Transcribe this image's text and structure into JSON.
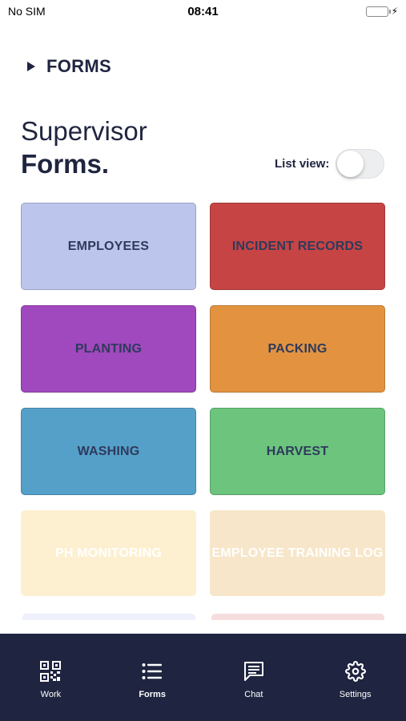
{
  "status_bar": {
    "carrier": "No SIM",
    "time": "08:41",
    "battery_color": "#3ac14a"
  },
  "header": {
    "section_title": "FORMS",
    "title_line1": "Supervisor",
    "title_line2": "Forms.",
    "list_view_label": "List view:",
    "list_view_on": false
  },
  "forms": [
    {
      "label": "EMPLOYEES",
      "color": "#bcc5ec"
    },
    {
      "label": "INCIDENT RECORDS",
      "color": "#c74444"
    },
    {
      "label": "PLANTING",
      "color": "#a048bd"
    },
    {
      "label": "PACKING",
      "color": "#e39340"
    },
    {
      "label": "WASHING",
      "color": "#55a0c9"
    },
    {
      "label": "HARVEST",
      "color": "#6cc47d"
    },
    {
      "label": "PH MONITORING",
      "color": "#fdf0d1"
    },
    {
      "label": "EMPLOYEE TRAINING LOG",
      "color": "#f7e6c9"
    }
  ],
  "bottom_nav": {
    "items": [
      {
        "label": "Work",
        "icon": "qr-code-icon"
      },
      {
        "label": "Forms",
        "icon": "list-icon",
        "active": true
      },
      {
        "label": "Chat",
        "icon": "chat-icon"
      },
      {
        "label": "Settings",
        "icon": "gear-icon"
      }
    ]
  }
}
